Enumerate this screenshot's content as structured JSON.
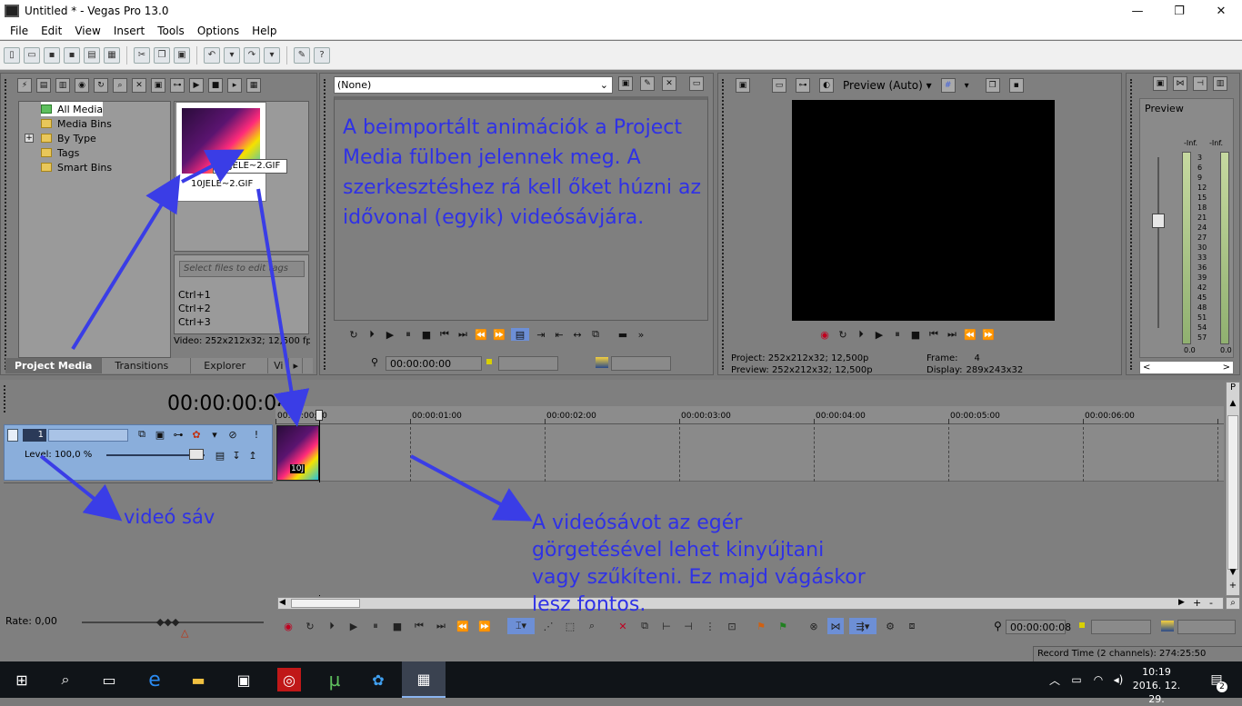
{
  "window": {
    "title": "Untitled * - Vegas Pro 13.0",
    "minimize": "—",
    "maximize": "❐",
    "close": "✕"
  },
  "menu": [
    "File",
    "Edit",
    "View",
    "Insert",
    "Tools",
    "Options",
    "Help"
  ],
  "project_media": {
    "tree": [
      "All Media",
      "Media Bins",
      "By Type",
      "Tags",
      "Smart Bins"
    ],
    "expand_glyph": "+",
    "file_name": "10JELE~2.GIF",
    "tooltip": "10JELE~2.GIF",
    "tags_placeholder": "Select files to edit tags",
    "shortcuts": [
      "Ctrl+1",
      "Ctrl+2",
      "Ctrl+3"
    ],
    "video_info": "Video: 252x212x32; 12,500 fps",
    "tabs": [
      "Project Media",
      "Transitions",
      "Explorer",
      "Vi"
    ]
  },
  "trimmer": {
    "dropdown_value": "(None)",
    "annotation": "A beimportált animációk a Project Media fülben jelennek meg. A szerkesztéshez rá kell őket húzni az idővonal (egyik) videósávjára.",
    "timecode": "00:00:00:00",
    "more_glyph": "»"
  },
  "preview": {
    "mode": "Preview (Auto)",
    "project_label": "Project:",
    "project_value": "252x212x32; 12,500p",
    "preview_label": "Preview:",
    "preview_value": "252x212x32; 12,500p",
    "frame_label": "Frame:",
    "frame_value": "4",
    "display_label": "Display:",
    "display_value": "289x243x32"
  },
  "master": {
    "title": "Preview",
    "inf_left": "-Inf.",
    "inf_right": "-Inf.",
    "scale": [
      "3",
      "6",
      "9",
      "12",
      "15",
      "18",
      "21",
      "24",
      "27",
      "30",
      "33",
      "36",
      "39",
      "42",
      "45",
      "48",
      "51",
      "54",
      "57"
    ],
    "bottom_left": "0.0",
    "bottom_right": "0.0",
    "scroll_left": "<",
    "scroll_right": ">"
  },
  "timeline": {
    "timecode": "00:00:00:08",
    "track_number": "1",
    "level_label": "Level: 100,0 %",
    "ruler": [
      "00:00:00:00",
      "00:00:01:00",
      "00:00:02:00",
      "00:00:03:00",
      "00:00:04:00",
      "00:00:05:00",
      "00:00:06:00"
    ],
    "clip_label": "10J",
    "annotation_track": "videó sáv",
    "annotation_scroll": "A videósávot az egér görgetésével lehet kinyújtani vagy szűkíteni. Ez majd vágáskor lesz fontos.",
    "rate_label": "Rate: 0,00",
    "bottom_timecode": "00:00:00:08",
    "record_time": "Record Time (2 channels): 274:25:50",
    "zoom_plus": "+",
    "zoom_minus": "-"
  },
  "taskbar": {
    "time": "10:19",
    "date": "2016. 12. 29.",
    "notify_count": "2"
  }
}
